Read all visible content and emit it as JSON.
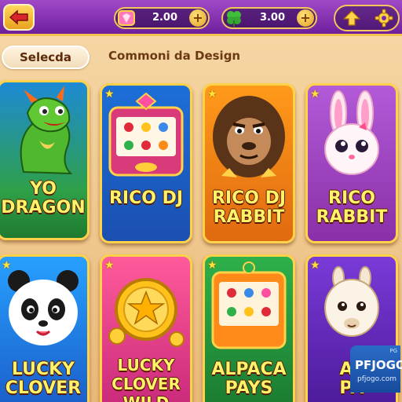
{
  "header": {
    "back_icon": "arrow-left-icon",
    "currency_left": {
      "icon": "gem-icon",
      "value": "2.00",
      "add": "+"
    },
    "currency_right": {
      "icon": "clover-icon",
      "value": "3.00",
      "add": "+"
    },
    "up_icon": "arrow-up-icon",
    "settings_icon": "gear-icon"
  },
  "tabs": {
    "active_label": "Selecda",
    "inactive_label": "Commoni da Design"
  },
  "games": [
    {
      "line1": "YO",
      "line2": "DRAGON",
      "icon": "dragon-icon"
    },
    {
      "line1": "RICO DJ",
      "line2": "",
      "icon": "slot-machine-icon"
    },
    {
      "line1": "RICO DJ",
      "line2": "RABBIT",
      "icon": "gorilla-icon"
    },
    {
      "line1": "RICO",
      "line2": "RABBIT",
      "icon": "rabbit-icon"
    },
    {
      "line1": "LUCKY",
      "line2": "CLOVER",
      "icon": "panda-icon"
    },
    {
      "line1": "LUCKY",
      "line2": "CLOVER WILD",
      "icon": "coin-icon"
    },
    {
      "line1": "ALPACA",
      "line2": "PAYS",
      "icon": "slot-machine-icon"
    },
    {
      "line1": "AL",
      "line2": "PA",
      "icon": "alpaca-icon"
    }
  ],
  "watermark": {
    "top": "PG",
    "brand": "PFJOGO",
    "url": "pfjogo.com"
  },
  "colors": {
    "topbar": "#8a33b5",
    "gold": "#ffd24a",
    "title_text": "#fff36a"
  }
}
